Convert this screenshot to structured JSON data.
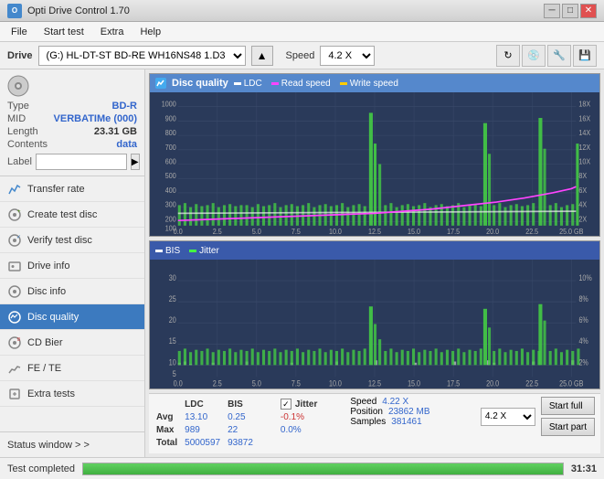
{
  "app": {
    "title": "Opti Drive Control 1.70",
    "icon_label": "ODC"
  },
  "titlebar": {
    "minimize_label": "─",
    "maximize_label": "□",
    "close_label": "✕"
  },
  "menubar": {
    "items": [
      "File",
      "Start test",
      "Extra",
      "Help"
    ]
  },
  "drivebar": {
    "drive_label": "Drive",
    "drive_value": "(G:)  HL-DT-ST BD-RE  WH16NS48 1.D3",
    "speed_label": "Speed",
    "speed_value": "4.2 X"
  },
  "disc": {
    "type_label": "Type",
    "type_value": "BD-R",
    "mid_label": "MID",
    "mid_value": "VERBATIMe (000)",
    "length_label": "Length",
    "length_value": "23.31 GB",
    "contents_label": "Contents",
    "contents_value": "data",
    "label_label": "Label",
    "label_placeholder": ""
  },
  "nav": {
    "items": [
      {
        "id": "transfer-rate",
        "label": "Transfer rate",
        "icon": "chart-icon"
      },
      {
        "id": "create-test-disc",
        "label": "Create test disc",
        "icon": "disc-create-icon"
      },
      {
        "id": "verify-test-disc",
        "label": "Verify test disc",
        "icon": "disc-verify-icon"
      },
      {
        "id": "drive-info",
        "label": "Drive info",
        "icon": "drive-icon"
      },
      {
        "id": "disc-info",
        "label": "Disc info",
        "icon": "disc-info-icon"
      },
      {
        "id": "disc-quality",
        "label": "Disc quality",
        "icon": "disc-quality-icon",
        "active": true
      },
      {
        "id": "cd-bier",
        "label": "CD Bier",
        "icon": "cd-icon"
      },
      {
        "id": "fe-te",
        "label": "FE / TE",
        "icon": "fe-icon"
      },
      {
        "id": "extra-tests",
        "label": "Extra tests",
        "icon": "extra-icon"
      }
    ],
    "status_window": "Status window > >"
  },
  "chart_top": {
    "title": "Disc quality",
    "legends": [
      {
        "label": "LDC",
        "color": "#ffffff"
      },
      {
        "label": "Read speed",
        "color": "#ff44ff"
      },
      {
        "label": "Write speed",
        "color": "#ffcc00"
      }
    ],
    "y_axis_left": [
      "1000",
      "900",
      "800",
      "700",
      "600",
      "500",
      "400",
      "300",
      "200",
      "100"
    ],
    "y_axis_right": [
      "18X",
      "16X",
      "14X",
      "12X",
      "10X",
      "8X",
      "6X",
      "4X",
      "2X"
    ],
    "x_axis": [
      "0.0",
      "2.5",
      "5.0",
      "7.5",
      "10.0",
      "12.5",
      "15.0",
      "17.5",
      "20.0",
      "22.5",
      "25.0 GB"
    ]
  },
  "chart_bottom": {
    "legends": [
      {
        "label": "BIS",
        "color": "#ffffff"
      },
      {
        "label": "Jitter",
        "color": "#44ff44"
      }
    ],
    "y_axis_left": [
      "30",
      "25",
      "20",
      "15",
      "10",
      "5"
    ],
    "y_axis_right": [
      "10%",
      "8%",
      "6%",
      "4%",
      "2%"
    ],
    "x_axis": [
      "0.0",
      "2.5",
      "5.0",
      "7.5",
      "10.0",
      "12.5",
      "15.0",
      "17.5",
      "20.0",
      "22.5",
      "25.0 GB"
    ]
  },
  "stats": {
    "headers": [
      "",
      "LDC",
      "BIS",
      "",
      "Jitter",
      "Speed",
      ""
    ],
    "avg_label": "Avg",
    "avg_ldc": "13.10",
    "avg_bis": "0.25",
    "avg_jitter": "-0.1%",
    "max_label": "Max",
    "max_ldc": "989",
    "max_bis": "22",
    "max_jitter": "0.0%",
    "total_label": "Total",
    "total_ldc": "5000597",
    "total_bis": "93872",
    "speed_label": "Speed",
    "speed_value": "4.22 X",
    "position_label": "Position",
    "position_value": "23862 MB",
    "samples_label": "Samples",
    "samples_value": "381461",
    "speed_select": "4.2 X",
    "start_full": "Start full",
    "start_part": "Start part",
    "jitter_checked": true,
    "jitter_label": "Jitter"
  },
  "statusbar": {
    "status_text": "Test completed",
    "progress": 100,
    "time": "31:31"
  }
}
